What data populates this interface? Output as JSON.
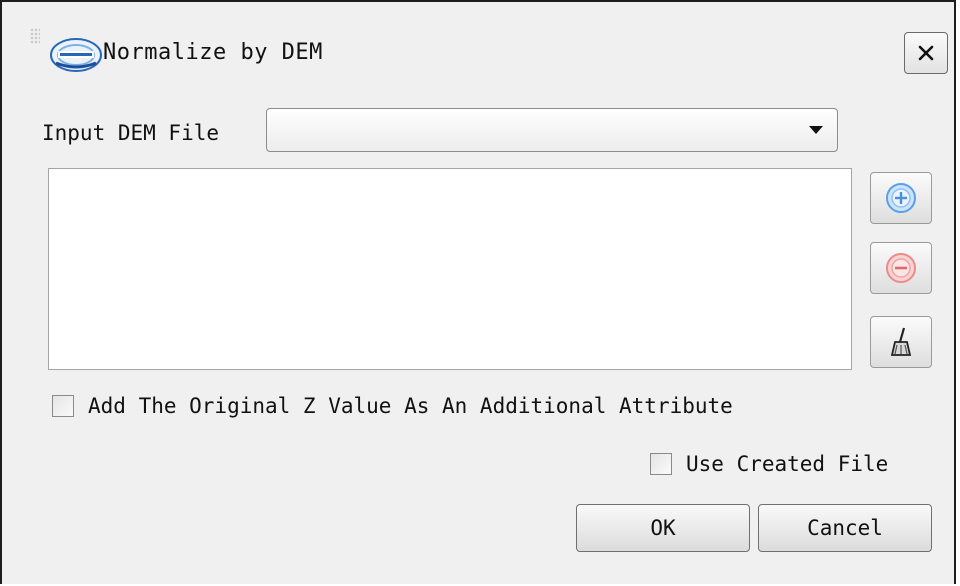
{
  "window": {
    "title": "Normalize by DEM",
    "logo_icon": "lidar360-logo-icon",
    "close_icon": "close-icon"
  },
  "dem": {
    "label": "Input DEM File",
    "selected_value": "",
    "dropdown_icon": "chevron-down-icon"
  },
  "file_list": {
    "items": []
  },
  "side_buttons": {
    "add_icon": "plus-circle-icon",
    "remove_icon": "minus-circle-icon",
    "clear_icon": "broom-icon"
  },
  "options": {
    "add_original_z_label": "Add The Original Z Value As An Additional Attribute",
    "add_original_z_checked": false,
    "use_created_file_label": "Use Created File",
    "use_created_file_checked": false
  },
  "buttons": {
    "ok_label": "OK",
    "cancel_label": "Cancel"
  },
  "colors": {
    "add_icon": "#5aa0e6",
    "remove_icon": "#ef8a8a",
    "dialog_bg": "#f0f0f0"
  }
}
